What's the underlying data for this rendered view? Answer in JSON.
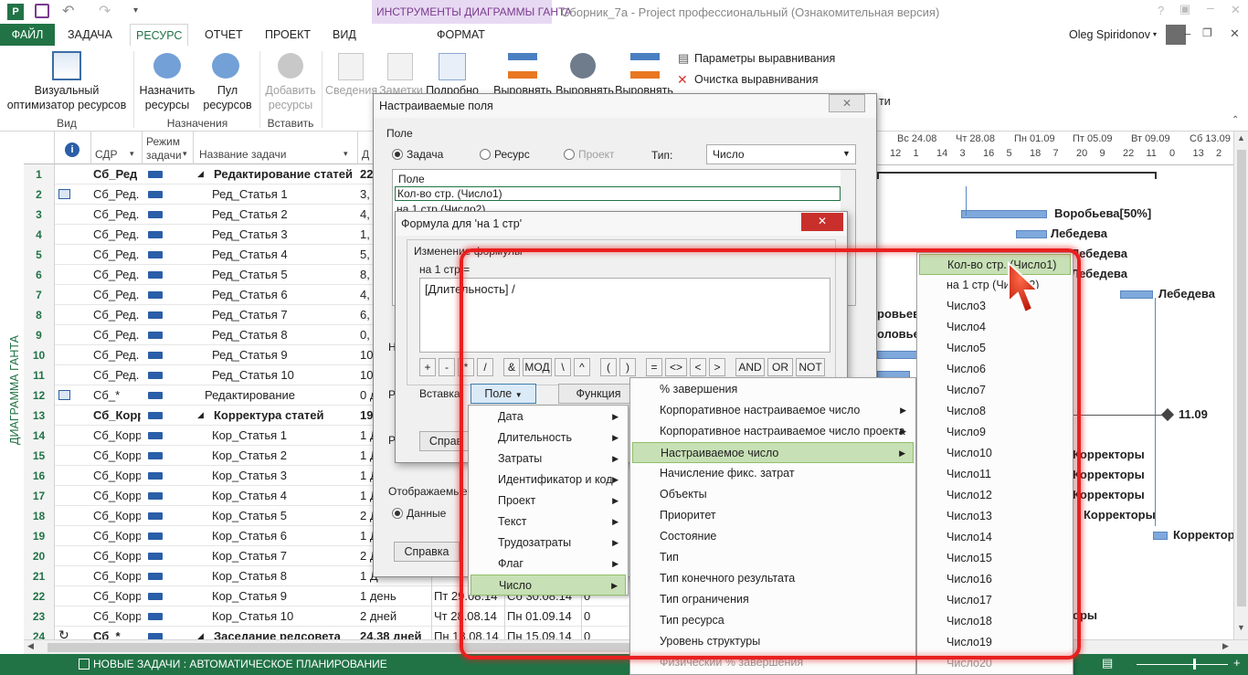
{
  "title_bar": {
    "contextual_tab_header": "ИНСТРУМЕНТЫ ДИАГРАММЫ ГАНТА",
    "window_title": "Сборник_7а - Project профессиональный (Ознакомительная версия)"
  },
  "ribbon_tabs": {
    "file": "ФАЙЛ",
    "task": "ЗАДАЧА",
    "resource": "РЕСУРС",
    "report": "ОТЧЕТ",
    "project": "ПРОЕКТ",
    "view": "ВИД",
    "format": "ФОРМАТ",
    "user": "Oleg Spiridonov"
  },
  "ribbon": {
    "visual_optimizer_line1": "Визуальный",
    "visual_optimizer_line2": "оптимизатор ресурсов",
    "group_view": "Вид",
    "assign_line1": "Назначить",
    "assign_line2": "ресурсы",
    "pool_line1": "Пул",
    "pool_line2": "ресурсов",
    "group_assignments": "Назначения",
    "add_line1": "Добавить",
    "add_line2": "ресурсы",
    "group_insert": "Вставить",
    "info": "Сведения",
    "notes": "Заметки",
    "details": "Подробно",
    "level1": "Выровнять",
    "level2": "Выровнять",
    "level3": "Выровнять",
    "leveling_options": "Параметры выравнивания",
    "clear_leveling": "Очистка выравнивания",
    "partial_right": "ти"
  },
  "grid": {
    "headers": {
      "wbs": "СДР",
      "mode_line1": "Режим",
      "mode_line2": "задачи",
      "name": "Название задачи",
      "dur": "Д"
    },
    "side_label": "ДИАГРАММА ГАНТА",
    "rows": [
      {
        "n": "1",
        "wbs": "Сб_Ред",
        "name": "Редактирование статей",
        "dur": "22",
        "bold": true,
        "summary": true,
        "ind": 0,
        "start": "",
        "finish": "",
        "extra": ""
      },
      {
        "n": "2",
        "wbs": "Сб_Ред.",
        "name": "Ред_Статья 1",
        "dur": "3,",
        "bold": false,
        "summary": false,
        "ind": 1,
        "start": "",
        "finish": "",
        "extra": ""
      },
      {
        "n": "3",
        "wbs": "Сб_Ред.",
        "name": "Ред_Статья 2",
        "dur": "4,",
        "bold": false,
        "summary": false,
        "ind": 1,
        "start": "",
        "finish": "",
        "extra": ""
      },
      {
        "n": "4",
        "wbs": "Сб_Ред.",
        "name": "Ред_Статья 3",
        "dur": "1,",
        "bold": false,
        "summary": false,
        "ind": 1,
        "start": "",
        "finish": "",
        "extra": ""
      },
      {
        "n": "5",
        "wbs": "Сб_Ред.",
        "name": "Ред_Статья 4",
        "dur": "5,",
        "bold": false,
        "summary": false,
        "ind": 1,
        "start": "",
        "finish": "",
        "extra": ""
      },
      {
        "n": "6",
        "wbs": "Сб_Ред.",
        "name": "Ред_Статья 5",
        "dur": "8,",
        "bold": false,
        "summary": false,
        "ind": 1,
        "start": "",
        "finish": "",
        "extra": ""
      },
      {
        "n": "7",
        "wbs": "Сб_Ред.",
        "name": "Ред_Статья 6",
        "dur": "4,",
        "bold": false,
        "summary": false,
        "ind": 1,
        "start": "",
        "finish": "",
        "extra": ""
      },
      {
        "n": "8",
        "wbs": "Сб_Ред.",
        "name": "Ред_Статья 7",
        "dur": "6,",
        "bold": false,
        "summary": false,
        "ind": 1,
        "start": "",
        "finish": "",
        "extra": ""
      },
      {
        "n": "9",
        "wbs": "Сб_Ред.",
        "name": "Ред_Статья 8",
        "dur": "0,",
        "bold": false,
        "summary": false,
        "ind": 1,
        "start": "",
        "finish": "",
        "extra": ""
      },
      {
        "n": "10",
        "wbs": "Сб_Ред.",
        "name": "Ред_Статья 9",
        "dur": "10",
        "bold": false,
        "summary": false,
        "ind": 1,
        "start": "",
        "finish": "",
        "extra": ""
      },
      {
        "n": "11",
        "wbs": "Сб_Ред.",
        "name": "Ред_Статья 10",
        "dur": "10",
        "bold": false,
        "summary": false,
        "ind": 1,
        "start": "",
        "finish": "",
        "extra": ""
      },
      {
        "n": "12",
        "wbs": "Сб_*",
        "name": "Редактирование",
        "dur": "0 д",
        "bold": false,
        "summary": false,
        "ind": 0.5,
        "start": "",
        "finish": "",
        "extra": ""
      },
      {
        "n": "13",
        "wbs": "Сб_Корр",
        "name": "Корректура статей",
        "dur": "19",
        "bold": true,
        "summary": true,
        "ind": 0,
        "start": "",
        "finish": "",
        "extra": ""
      },
      {
        "n": "14",
        "wbs": "Сб_Корр",
        "name": "Кор_Статья 1",
        "dur": "1 Д",
        "bold": false,
        "summary": false,
        "ind": 1,
        "start": "",
        "finish": "",
        "extra": ""
      },
      {
        "n": "15",
        "wbs": "Сб_Корр",
        "name": "Кор_Статья 2",
        "dur": "1 Д",
        "bold": false,
        "summary": false,
        "ind": 1,
        "start": "",
        "finish": "",
        "extra": ""
      },
      {
        "n": "16",
        "wbs": "Сб_Корр",
        "name": "Кор_Статья 3",
        "dur": "1 Д",
        "bold": false,
        "summary": false,
        "ind": 1,
        "start": "",
        "finish": "",
        "extra": ""
      },
      {
        "n": "17",
        "wbs": "Сб_Корр",
        "name": "Кор_Статья 4",
        "dur": "1 Д",
        "bold": false,
        "summary": false,
        "ind": 1,
        "start": "",
        "finish": "",
        "extra": ""
      },
      {
        "n": "18",
        "wbs": "Сб_Корр",
        "name": "Кор_Статья 5",
        "dur": "2 Д",
        "bold": false,
        "summary": false,
        "ind": 1,
        "start": "",
        "finish": "",
        "extra": ""
      },
      {
        "n": "19",
        "wbs": "Сб_Корр",
        "name": "Кор_Статья 6",
        "dur": "1 Д",
        "bold": false,
        "summary": false,
        "ind": 1,
        "start": "",
        "finish": "",
        "extra": ""
      },
      {
        "n": "20",
        "wbs": "Сб_Корр",
        "name": "Кор_Статья 7",
        "dur": "2 Д",
        "bold": false,
        "summary": false,
        "ind": 1,
        "start": "",
        "finish": "",
        "extra": ""
      },
      {
        "n": "21",
        "wbs": "Сб_Корр",
        "name": "Кор_Статья 8",
        "dur": "1 Д",
        "bold": false,
        "summary": false,
        "ind": 1,
        "start": "",
        "finish": "",
        "extra": ""
      },
      {
        "n": "22",
        "wbs": "Сб_Корр",
        "name": "Кор_Статья 9",
        "dur": "1 день",
        "bold": false,
        "summary": false,
        "ind": 1,
        "start": "Пт 29.08.14",
        "finish": "Сб 30.08.14",
        "extra": "0"
      },
      {
        "n": "23",
        "wbs": "Сб_Корр",
        "name": "Кор_Статья 10",
        "dur": "2 дней",
        "bold": false,
        "summary": false,
        "ind": 1,
        "start": "Чт 28.08.14",
        "finish": "Пн 01.09.14",
        "extra": "0"
      },
      {
        "n": "24",
        "wbs": "Сб_*",
        "name": "Заседание редсовета",
        "dur": "24,38 дней",
        "bold": true,
        "summary": true,
        "ind": 0,
        "start": "Пн 18.08.14",
        "finish": "Пн 15.09.14",
        "extra": "0"
      }
    ]
  },
  "gantt": {
    "dates": [
      "Вс 24.08",
      "Чт 28.08",
      "Пн 01.09",
      "Пт 05.09",
      "Вт 09.09",
      "Сб 13.09"
    ],
    "ticks": [
      "12",
      "1",
      "14",
      "3",
      "16",
      "5",
      "18",
      "7",
      "20",
      "9",
      "22",
      "11",
      "0",
      "13",
      "2"
    ],
    "labels": [
      "Воробьева[50%]",
      "Лебедева",
      "Лебедева",
      "Лебедева",
      "Лебедева",
      "ровьева",
      "оловье",
      "11.09",
      "Корректоры",
      "Корректоры",
      "Корректоры",
      "Корректоры",
      "Корректор",
      "оры"
    ]
  },
  "status_bar": {
    "text": "НОВЫЕ ЗАДАЧИ : АВТОМАТИЧЕСКОЕ ПЛАНИРОВАНИЕ"
  },
  "custom_fields_dialog": {
    "title": "Настраиваемые поля",
    "field_label": "Поле",
    "task_radio": "Задача",
    "resource_radio": "Ресурс",
    "project_radio": "Проект",
    "type_label": "Тип:",
    "type_value": "Число",
    "list_header": "Поле",
    "list_items": [
      "Кол-во стр. (Число1)",
      "на 1 стр (Число2)"
    ],
    "partial_ha": "На",
    "partial_ra1": "Ра",
    "partial_ra2": "Ра",
    "display_label": "Отображаемые з",
    "data_radio": "Данные",
    "help_button": "Справка",
    "help_partial": "Справ"
  },
  "formula_dialog": {
    "title": "Формула для 'на 1 стр'",
    "edit_label": "Изменение формулы",
    "field_eq": "на 1 стр =",
    "formula_text": "[Длительность] /",
    "operators": [
      "+",
      "-",
      "*",
      "/",
      "&",
      "МОД",
      "\\",
      "^",
      "(",
      ")",
      "=",
      "<>",
      "<",
      ">",
      "AND",
      "OR",
      "NOT"
    ],
    "insert_label": "Вставка:",
    "field_button": "Поле",
    "function_button": "Функция"
  },
  "menu_field": {
    "items": [
      "Дата",
      "Длительность",
      "Затраты",
      "Идентификатор и код",
      "Проект",
      "Текст",
      "Трудозатраты",
      "Флаг",
      "Число"
    ]
  },
  "menu_number": {
    "items": [
      "% завершения",
      "Корпоративное настраиваемое число",
      "Корпоративное настраиваемое число проекта",
      "Настраиваемое число",
      "Начисление фикс. затрат",
      "Объекты",
      "Приоритет",
      "Состояние",
      "Тип",
      "Тип конечного результата",
      "Тип ограничения",
      "Тип ресурса",
      "Уровень структуры",
      "Физический % завершения"
    ]
  },
  "menu_custom": {
    "items": [
      "Кол-во стр. (Число1)",
      "на 1 стр (Число2)",
      "Число3",
      "Число4",
      "Число5",
      "Число6",
      "Число7",
      "Число8",
      "Число9",
      "Число10",
      "Число11",
      "Число12",
      "Число13",
      "Число14",
      "Число15",
      "Число16",
      "Число17",
      "Число18",
      "Число19",
      "Число20"
    ]
  },
  "colors": {
    "accent": "#217346",
    "contextual": "#e8d9f2",
    "highlight_ring": "#e8201f",
    "menu_selected": "#c7e0b5",
    "gantt_bar": "#7fa9dc"
  }
}
